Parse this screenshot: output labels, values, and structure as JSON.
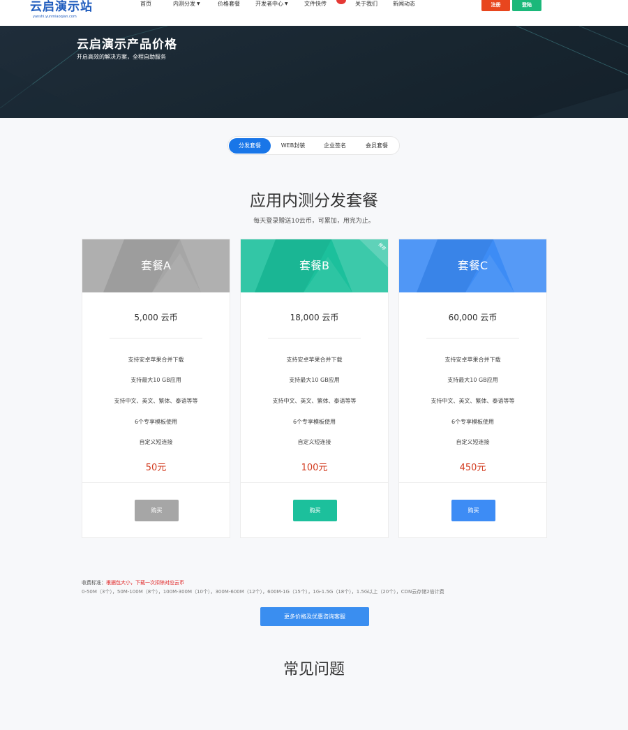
{
  "brand": {
    "name": "云启演示站",
    "domain": "yanshi.yunmiaoqian.com"
  },
  "nav": {
    "items": [
      {
        "label": "首页",
        "has_dropdown": false
      },
      {
        "label": "内测分发",
        "has_dropdown": true
      },
      {
        "label": "价格套餐",
        "has_dropdown": false
      },
      {
        "label": "开发者中心",
        "has_dropdown": true
      },
      {
        "label": "文件快传",
        "has_dropdown": false
      },
      {
        "label": "关于我们",
        "has_dropdown": false
      },
      {
        "label": "新闻动态",
        "has_dropdown": false
      }
    ],
    "register_label": "注册",
    "login_label": "登陆",
    "caret_icon": "chevron-down-icon"
  },
  "banner": {
    "title": "云启演示产品价格",
    "subtitle": "开启高效的解决方案，全程自助服务"
  },
  "tabs": [
    {
      "label": "分发套餐",
      "active": true
    },
    {
      "label": "WEB封装",
      "active": false
    },
    {
      "label": "企业签名",
      "active": false
    },
    {
      "label": "会员套餐",
      "active": false
    }
  ],
  "section": {
    "title": "应用内测分发套餐",
    "subtitle": "每天登录赠送10云币，可累加，用完为止。"
  },
  "plans": [
    {
      "name": "套餐A",
      "credits": "5,000 云币",
      "features": [
        "支持安卓苹果合并下载",
        "支持最大10 GB应用",
        "支持中文、英文、繁体、泰语等等",
        "6个专享模板使用",
        "自定义短连接"
      ],
      "price": "50元",
      "buy_label": "购买",
      "color": "#a6a6a6",
      "ribbon": ""
    },
    {
      "name": "套餐B",
      "credits": "18,000 云币",
      "features": [
        "支持安卓苹果合并下载",
        "支持最大10 GB应用",
        "支持中文、英文、繁体、泰语等等",
        "6个专享模板使用",
        "自定义短连接"
      ],
      "price": "100元",
      "buy_label": "购买",
      "color": "#1cc09c",
      "ribbon": "推荐"
    },
    {
      "name": "套餐C",
      "credits": "60,000 云币",
      "features": [
        "支持安卓苹果合并下载",
        "支持最大10 GB应用",
        "支持中文、英文、繁体、泰语等等",
        "6个专享模板使用",
        "自定义短连接"
      ],
      "price": "450元",
      "buy_label": "购买",
      "color": "#3d8cf5",
      "ribbon": ""
    }
  ],
  "fees": {
    "label": "收费标准：",
    "highlight": "根据包大小，下载一次扣除对应云币",
    "tiers": "0-50M（3个），50M-100M（8个），100M-300M（10个），300M-600M（12个），600M-1G（15个），1G-1.5G（18个），1.5G以上（20个），CDN云存储2倍计费"
  },
  "more_button": "更多价格及优惠咨询客服",
  "faq": {
    "title": "常见问题"
  },
  "colors": {
    "register": "#e8461e",
    "login": "#1bb87a",
    "accent": "#1976e8",
    "price": "#d23a1e"
  }
}
